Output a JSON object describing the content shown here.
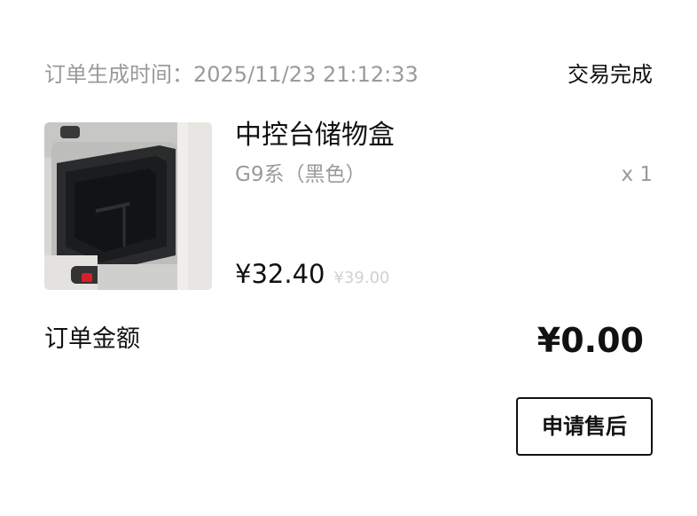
{
  "order": {
    "time_label": "订单生成时间：",
    "time_value": "2025/11/23 21:12:33",
    "status": "交易完成"
  },
  "product": {
    "title": "中控台储物盒",
    "variant": "G9系（黑色）",
    "quantity": "x 1",
    "price_current": "¥32.40",
    "price_original": "¥39.00"
  },
  "summary": {
    "amount_label": "订单金额",
    "amount_value": "¥0.00"
  },
  "actions": {
    "after_sale_label": "申请售后"
  }
}
